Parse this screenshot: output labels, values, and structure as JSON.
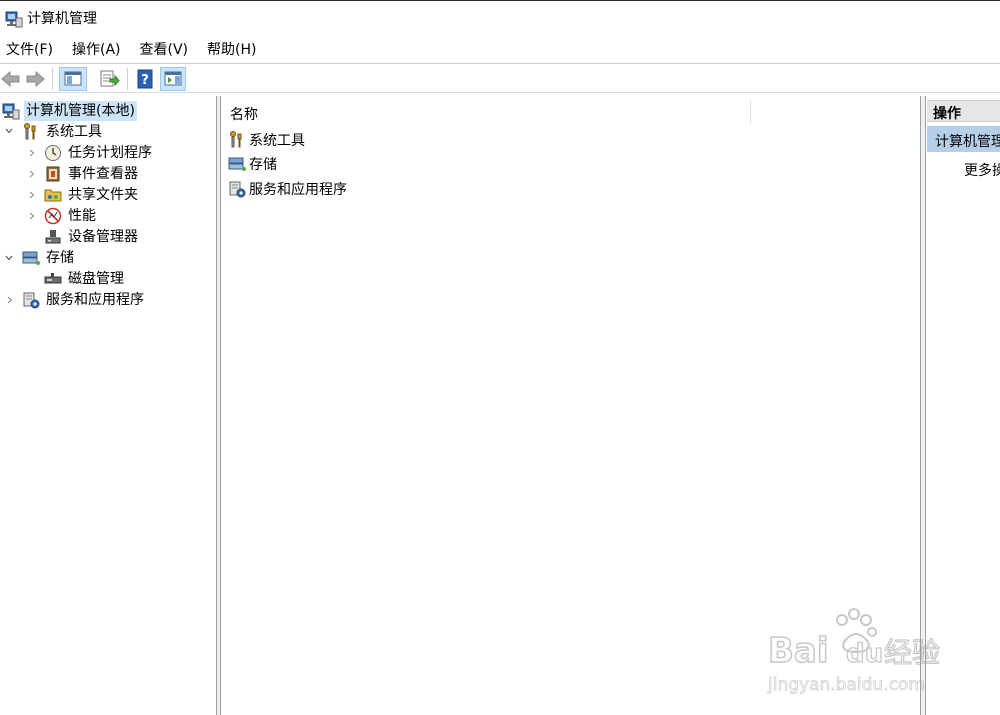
{
  "window": {
    "title": "计算机管理"
  },
  "menu": [
    "文件(F)",
    "操作(A)",
    "查看(V)",
    "帮助(H)"
  ],
  "toolbar": {
    "buttons": [
      "back-icon",
      "forward-icon",
      "show-hide-tree-icon",
      "export-list-icon",
      "help-icon",
      "show-hide-action-pane-icon"
    ]
  },
  "tree": {
    "root": "计算机管理(本地)",
    "system_tools": "系统工具",
    "task_scheduler": "任务计划程序",
    "event_viewer": "事件查看器",
    "shared_folders": "共享文件夹",
    "performance": "性能",
    "device_manager": "设备管理器",
    "storage": "存储",
    "disk_management": "磁盘管理",
    "services_apps": "服务和应用程序"
  },
  "list": {
    "column_name": "名称",
    "items": [
      "系统工具",
      "存储",
      "服务和应用程序"
    ]
  },
  "actions": {
    "header": "操作",
    "section": "计算机管理",
    "more": "更多操作"
  },
  "watermark": {
    "brand": "Bai du 经验",
    "url": "jingyan.baidu.com"
  }
}
